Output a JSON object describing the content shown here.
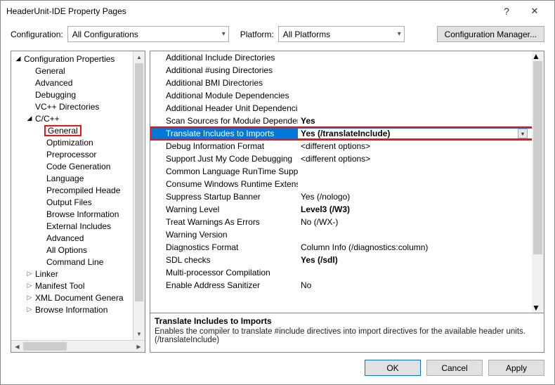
{
  "window": {
    "title": "HeaderUnit-IDE Property Pages"
  },
  "config": {
    "label": "Configuration:",
    "value": "All Configurations",
    "platform_label": "Platform:",
    "platform_value": "All Platforms",
    "manager_btn": "Configuration Manager..."
  },
  "tree": {
    "root": "Configuration Properties",
    "items_top": [
      "General",
      "Advanced",
      "Debugging",
      "VC++ Directories"
    ],
    "cc": "C/C++",
    "cc_items": [
      "General",
      "Optimization",
      "Preprocessor",
      "Code Generation",
      "Language",
      "Precompiled Heade",
      "Output Files",
      "Browse Information",
      "External Includes",
      "Advanced",
      "All Options",
      "Command Line"
    ],
    "items_bottom": [
      "Linker",
      "Manifest Tool",
      "XML Document Genera",
      "Browse Information"
    ]
  },
  "props": [
    {
      "name": "Additional Include Directories",
      "value": ""
    },
    {
      "name": "Additional #using Directories",
      "value": ""
    },
    {
      "name": "Additional BMI Directories",
      "value": ""
    },
    {
      "name": "Additional Module Dependencies",
      "value": ""
    },
    {
      "name": "Additional Header Unit Dependencies",
      "value": ""
    },
    {
      "name": "Scan Sources for Module Dependencies",
      "value": "Yes",
      "bold": true
    },
    {
      "name": "Translate Includes to Imports",
      "value": "Yes (/translateInclude)",
      "selected": true
    },
    {
      "name": "Debug Information Format",
      "value": "<different options>"
    },
    {
      "name": "Support Just My Code Debugging",
      "value": "<different options>"
    },
    {
      "name": "Common Language RunTime Support",
      "value": ""
    },
    {
      "name": "Consume Windows Runtime Extension",
      "value": ""
    },
    {
      "name": "Suppress Startup Banner",
      "value": "Yes (/nologo)"
    },
    {
      "name": "Warning Level",
      "value": "Level3 (/W3)",
      "bold": true
    },
    {
      "name": "Treat Warnings As Errors",
      "value": "No (/WX-)"
    },
    {
      "name": "Warning Version",
      "value": ""
    },
    {
      "name": "Diagnostics Format",
      "value": "Column Info (/diagnostics:column)"
    },
    {
      "name": "SDL checks",
      "value": "Yes (/sdl)",
      "bold": true
    },
    {
      "name": "Multi-processor Compilation",
      "value": ""
    },
    {
      "name": "Enable Address Sanitizer",
      "value": "No"
    }
  ],
  "desc": {
    "title": "Translate Includes to Imports",
    "text": "Enables the compiler to translate #include directives into import directives for the available header units. (/translateInclude)"
  },
  "buttons": {
    "ok": "OK",
    "cancel": "Cancel",
    "apply": "Apply"
  }
}
